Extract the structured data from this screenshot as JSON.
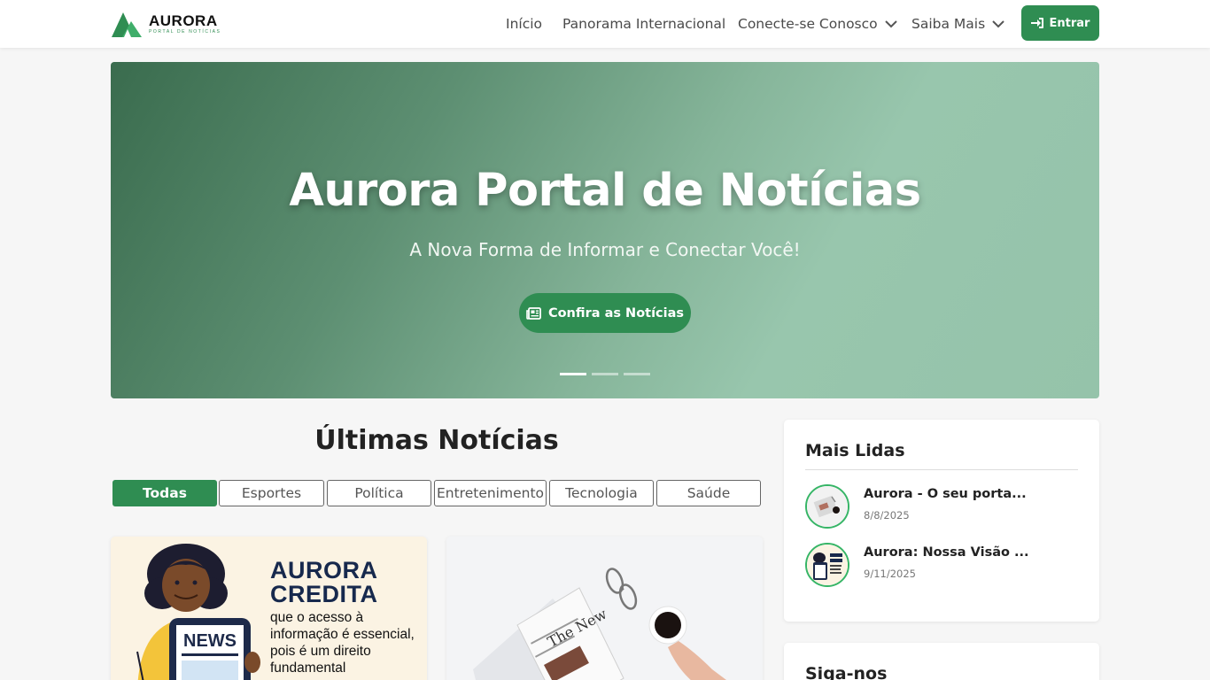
{
  "header": {
    "logo_title": "AURORA",
    "logo_subtitle": "PORTAL DE NOTÍCIAS",
    "nav": [
      {
        "label": "Início"
      },
      {
        "label": "Panorama Internacional"
      },
      {
        "label": "Conecte-se Conosco",
        "has_dropdown": true
      },
      {
        "label": "Saiba Mais",
        "has_dropdown": true
      }
    ],
    "login_label": "Entrar",
    "login_icon": "sign-in-icon"
  },
  "hero": {
    "title": "Aurora Portal de Notícias",
    "subtitle": "A Nova Forma de Informar e Conectar Você!",
    "button_label": "Confira as Notícias",
    "button_icon": "newspaper-icon",
    "slides_total": 3,
    "active_slide": 1
  },
  "latest": {
    "title": "Últimas Notícias",
    "filters": [
      "Todas",
      "Esportes",
      "Política",
      "Entretenimento",
      "Tecnologia",
      "Saúde"
    ],
    "active_filter": "Todas",
    "cards": [
      {
        "headline": "AURORA CREDITA",
        "body": "que o acesso à informação é essencial, pois é um direito fundamental",
        "badge": "NEWS"
      },
      {
        "newspaper_masthead": "The New"
      }
    ]
  },
  "sidebar": {
    "most_read_title": "Mais Lidas",
    "most_read": [
      {
        "title": "Aurora - O seu porta...",
        "date": "8/8/2025"
      },
      {
        "title": "Aurora: Nossa Visão ...",
        "date": "9/11/2025"
      }
    ],
    "follow_title": "Siga-nos"
  },
  "colors": {
    "brand_green": "#2f8d52",
    "accent_green": "#36b566",
    "navy": "#17294d"
  }
}
